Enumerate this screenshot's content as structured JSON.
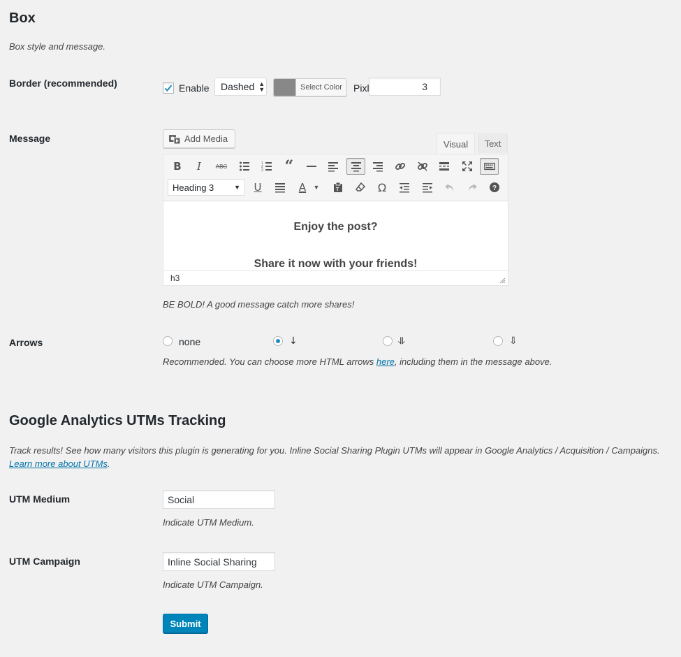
{
  "box": {
    "title": "Box",
    "description": "Box style and message."
  },
  "border": {
    "label": "Border (recommended)",
    "enable_label": "Enable",
    "enabled": true,
    "style_value": "Dashed",
    "color_button": "Select Color",
    "color_value": "#888888",
    "pixel_label": "Pixl",
    "pixel_value": "3"
  },
  "message": {
    "label": "Message",
    "add_media": "Add Media",
    "tab_visual": "Visual",
    "tab_text": "Text",
    "format_value": "Heading 3",
    "content_line1": "Enjoy the post?",
    "content_line2": "Share it now with your friends!",
    "path": "h3",
    "hint": "BE BOLD! A good message catch more shares!"
  },
  "arrows": {
    "label": "Arrows",
    "options": [
      {
        "label": "none",
        "selected": false
      },
      {
        "label": "↓",
        "selected": true
      },
      {
        "label": "⥥",
        "selected": false
      },
      {
        "label": "⇩",
        "selected": false
      }
    ],
    "hint_before": "Recommended. You can choose more HTML arrows ",
    "hint_link": "here",
    "hint_after": ", including them in the message above."
  },
  "analytics": {
    "title": "Google Analytics UTMs Tracking",
    "description": "Track results! See how many visitors this plugin is generating for you. Inline Social Sharing Plugin UTMs will appear in Google Analytics / Acquisition / Campaigns.",
    "learn_more": "Learn more about UTMs",
    "learn_more_suffix": "."
  },
  "utm_medium": {
    "label": "UTM Medium",
    "value": "Social",
    "hint": "Indicate UTM Medium."
  },
  "utm_campaign": {
    "label": "UTM Campaign",
    "value": "Inline Social Sharing",
    "hint": "Indicate UTM Campaign."
  },
  "submit_label": "Submit"
}
